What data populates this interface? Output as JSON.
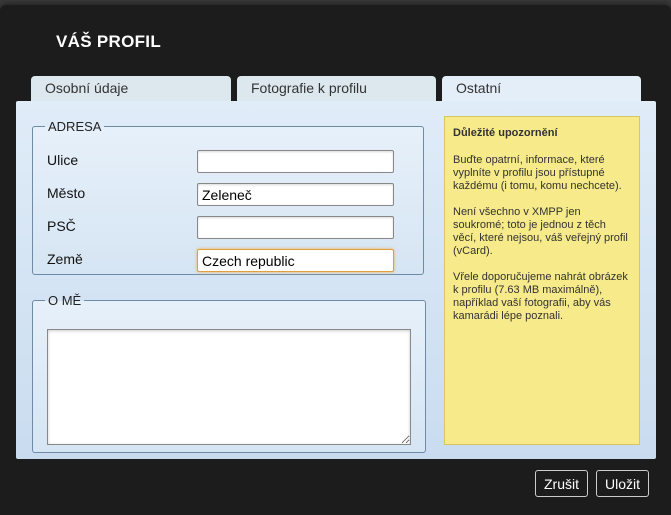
{
  "dialog": {
    "title": "VÁŠ PROFIL"
  },
  "tabs": [
    {
      "label": "Osobní údaje",
      "active": false
    },
    {
      "label": "Fotografie k profilu",
      "active": false
    },
    {
      "label": "Ostatní",
      "active": true
    }
  ],
  "address": {
    "legend": "ADRESA",
    "street": {
      "label": "Ulice",
      "value": ""
    },
    "city": {
      "label": "Město",
      "value": "Zeleneč"
    },
    "zip": {
      "label": "PSČ",
      "value": ""
    },
    "country": {
      "label": "Země",
      "value": "Czech republic"
    }
  },
  "about": {
    "legend": "O MĚ",
    "value": ""
  },
  "note": {
    "title": "Důležité upozornění",
    "paragraphs": [
      "Buďte opatrní, informace, které vyplníte v profilu jsou přístupné každému (i tomu, komu nechcete).",
      "Není všechno v XMPP jen soukromé; toto je jednou z těch věcí, které nejsou, váš veřejný profil (vCard).",
      "Vřele doporučujeme nahrát obrázek k profilu (7.63 MB maximálně), například vaší fotografii, aby vás kamarádi lépe poznali."
    ],
    "color": "#f6ea8a"
  },
  "buttons": {
    "cancel": "Zrušit",
    "save": "Uložit"
  }
}
